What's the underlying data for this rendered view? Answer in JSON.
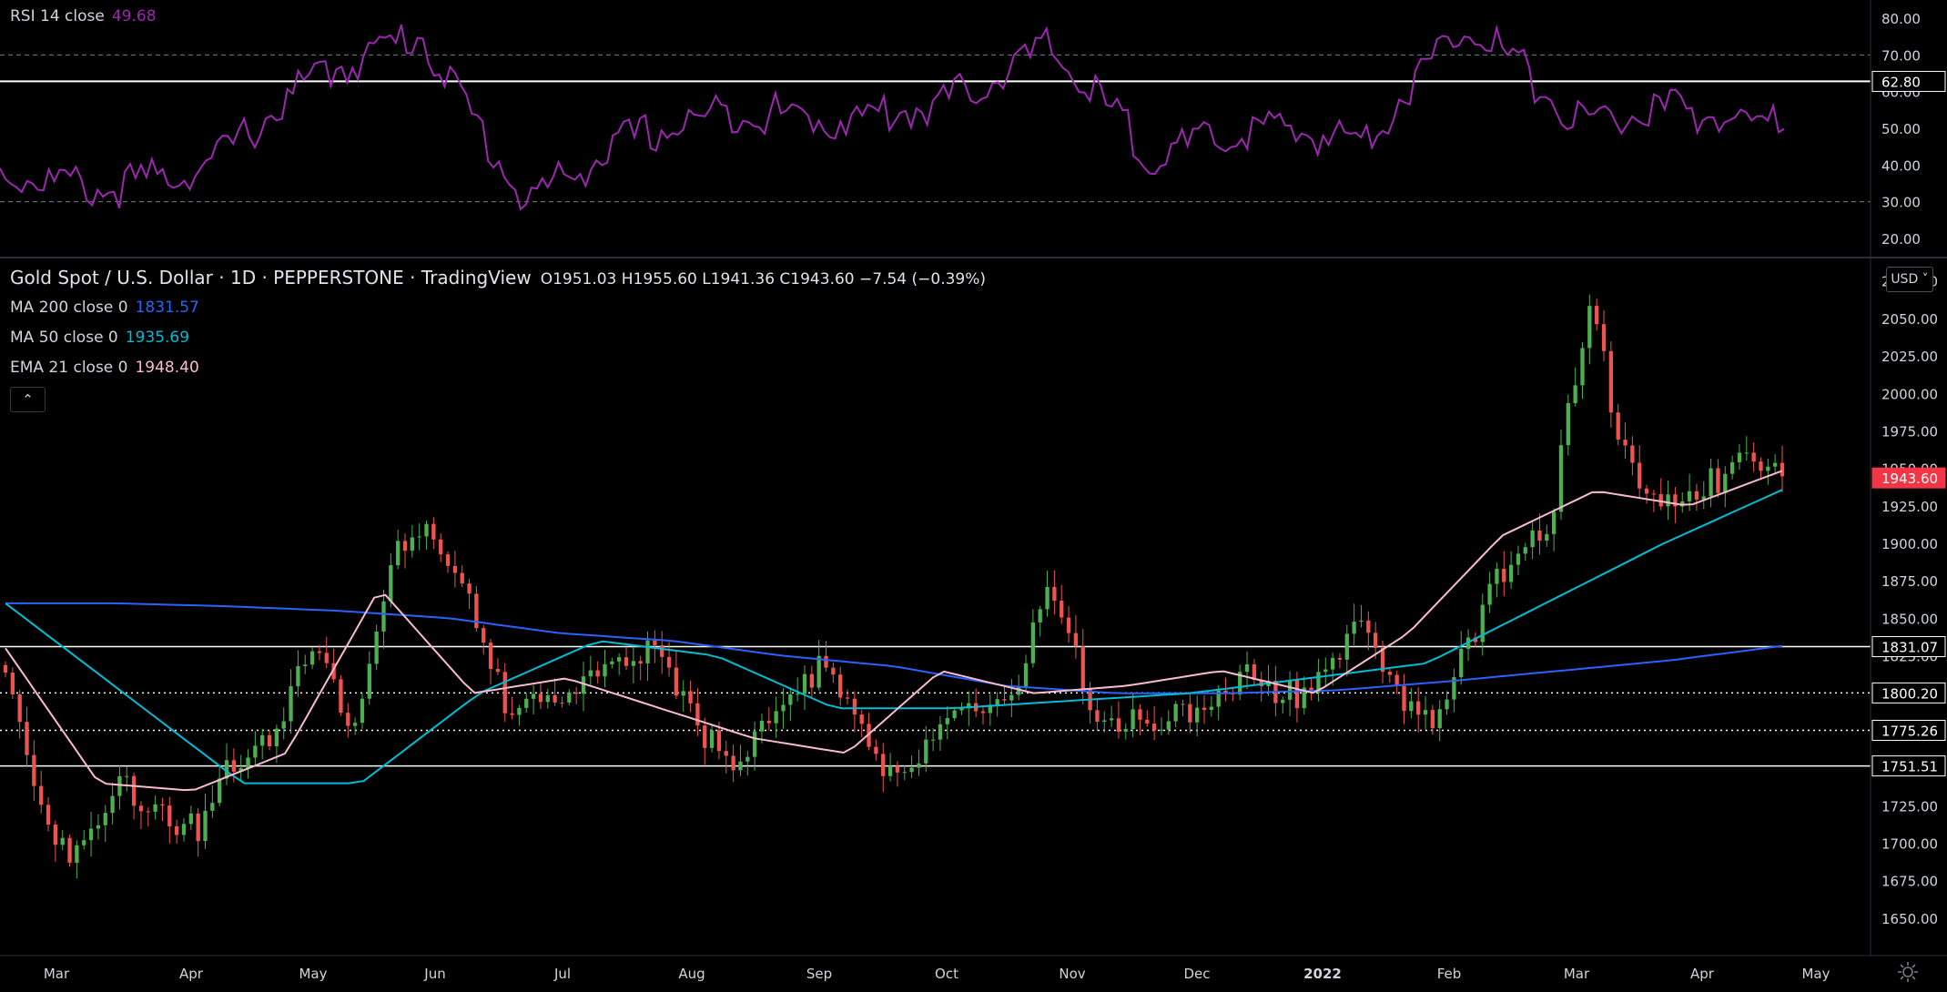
{
  "colors": {
    "background": "#000000",
    "grid_text": "#d1d4dc",
    "rsi_line": "#9c27b0",
    "up_candle": "#26a69a",
    "up_candle_fill": "#4caf50",
    "down_candle": "#ef5350",
    "ma200": "#2962ff",
    "ma50": "#00bcd4",
    "ema21": "#f8bbd0",
    "price_badge": "#f23645",
    "hline": "#ffffff"
  },
  "rsi": {
    "label": "RSI 14 close",
    "value": "49.68",
    "levels": [
      "80.00",
      "70.00",
      "60.00",
      "50.00",
      "40.00",
      "30.00",
      "20.00"
    ],
    "marker": "62.80"
  },
  "header": {
    "title": "Gold Spot / U.S. Dollar · 1D · PEPPERSTONE · TradingView",
    "ohlc": "O1951.03 H1955.60 L1941.36 C1943.60 −7.54 (−0.39%)"
  },
  "indicators": {
    "ma200": {
      "label": "MA 200 close 0",
      "value": "1831.57"
    },
    "ma50": {
      "label": "MA 50 close 0",
      "value": "1935.69"
    },
    "ema21": {
      "label": "EMA 21 close 0",
      "value": "1948.40"
    }
  },
  "controls": {
    "collapse": "⌃",
    "currency": "USD ˅",
    "settings_icon": "gear-icon"
  },
  "chart_data": [
    {
      "type": "line",
      "x": [
        "Mar",
        "Apr",
        "May",
        "Jun",
        "Jul",
        "Aug",
        "Sep",
        "Oct",
        "Nov",
        "Dec",
        "2022",
        "Feb",
        "Mar",
        "Apr"
      ],
      "series": [
        {
          "name": "RSI 14 close",
          "values": [
            38,
            33,
            40,
            64,
            76,
            30,
            47,
            55,
            52,
            57,
            72,
            42,
            50,
            47,
            80,
            52,
            55,
            50
          ]
        }
      ],
      "ylim": [
        15,
        85
      ],
      "yticks": [
        "80.00",
        "70.00",
        "60.00",
        "50.00",
        "40.00",
        "30.00",
        "20.00"
      ],
      "reference_lines": [
        "70.00",
        "30.00",
        "62.80"
      ],
      "grid": false
    },
    {
      "type": "line",
      "title": "Gold Spot / U.S. Dollar · 1D · PEPPERSTONE · TradingView",
      "xticks": [
        "Mar",
        "Apr",
        "May",
        "Jun",
        "Jul",
        "Aug",
        "Sep",
        "Oct",
        "Nov",
        "Dec",
        "2022",
        "Feb",
        "Mar",
        "Apr",
        "May"
      ],
      "yticks": [
        "2075.00",
        "2050.00",
        "2025.00",
        "2000.00",
        "1975.00",
        "1950.00",
        "1925.00",
        "1900.00",
        "1875.00",
        "1850.00",
        "1825.00",
        "1800.00",
        "1775.00",
        "1750.00",
        "1725.00",
        "1700.00",
        "1675.00",
        "1650.00"
      ],
      "ylim": [
        1625,
        2090
      ],
      "price_axis_labels": [
        "1943.60",
        "1831.07",
        "1800.20",
        "1775.26",
        "1751.51"
      ],
      "horizontal_lines": [
        {
          "value": 1831.07,
          "style": "solid"
        },
        {
          "value": 1800.2,
          "style": "dotted"
        },
        {
          "value": 1775.26,
          "style": "dotted"
        },
        {
          "value": 1751.51,
          "style": "solid"
        }
      ],
      "series": [
        {
          "name": "Close",
          "values": [
            1810,
            1720,
            1690,
            1740,
            1730,
            1700,
            1760,
            1780,
            1830,
            1780,
            1890,
            1900,
            1870,
            1780,
            1790,
            1820,
            1810,
            1830,
            1780,
            1740,
            1800,
            1820,
            1780,
            1750,
            1760,
            1790,
            1800,
            1860,
            1800,
            1780,
            1770,
            1800,
            1810,
            1790,
            1820,
            1840,
            1800,
            1790,
            1830,
            1900,
            1920,
            2050,
            1960,
            1920,
            1930,
            1975,
            1943.6
          ]
        },
        {
          "name": "MA 200 close 0",
          "values": [
            1860,
            1860,
            1858,
            1855,
            1850,
            1840,
            1835,
            1825,
            1818,
            1805,
            1800,
            1800,
            1802,
            1808,
            1815,
            1822,
            1831.57
          ]
        },
        {
          "name": "MA 50 close 0",
          "values": [
            1860,
            1800,
            1740,
            1740,
            1800,
            1835,
            1825,
            1790,
            1790,
            1795,
            1800,
            1810,
            1820,
            1860,
            1900,
            1935.69
          ]
        },
        {
          "name": "EMA 21 close 0",
          "values": [
            1830,
            1740,
            1735,
            1760,
            1870,
            1800,
            1810,
            1790,
            1770,
            1760,
            1815,
            1800,
            1805,
            1815,
            1800,
            1840,
            1905,
            1935,
            1925,
            1948.4
          ]
        }
      ]
    }
  ]
}
